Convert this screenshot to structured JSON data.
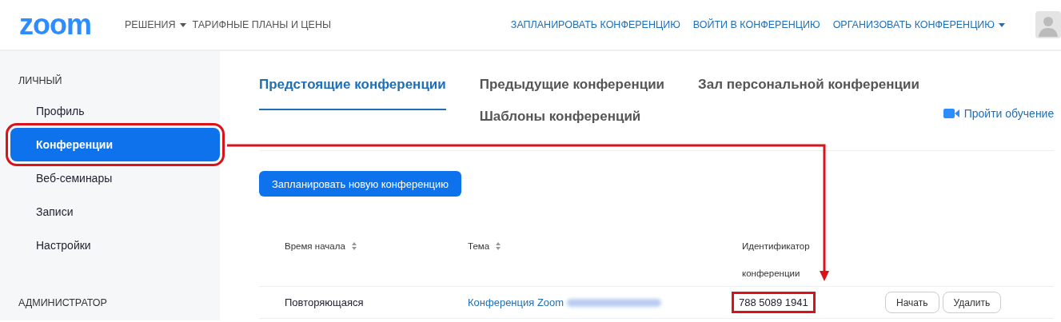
{
  "header": {
    "logo": "zoom",
    "nav_left": [
      {
        "label": "РЕШЕНИЯ",
        "dropdown": true
      },
      {
        "label": "ТАРИФНЫЕ ПЛАНЫ И ЦЕНЫ",
        "dropdown": false
      }
    ],
    "nav_right": [
      {
        "label": "ЗАПЛАНИРОВАТЬ КОНФЕРЕНЦИЮ",
        "dropdown": false
      },
      {
        "label": "ВОЙТИ В КОНФЕРЕНЦИЮ",
        "dropdown": false
      },
      {
        "label": "ОРГАНИЗОВАТЬ КОНФЕРЕНЦИЮ",
        "dropdown": true
      }
    ]
  },
  "sidebar": {
    "sections": [
      {
        "title": "ЛИЧНЫЙ",
        "items": [
          {
            "label": "Профиль",
            "selected": false,
            "highlighted": false
          },
          {
            "label": "Конференции",
            "selected": true,
            "highlighted": true
          },
          {
            "label": "Веб-семинары",
            "selected": false,
            "highlighted": false
          },
          {
            "label": "Записи",
            "selected": false,
            "highlighted": false
          },
          {
            "label": "Настройки",
            "selected": false,
            "highlighted": false
          }
        ]
      },
      {
        "title": "АДМИНИСТРАТОР"
      }
    ]
  },
  "tabs": [
    {
      "label": "Предстоящие конференции",
      "selected": true
    },
    {
      "label": "Предыдущие конференции",
      "selected": false
    },
    {
      "label": "Зал персональной конференции",
      "selected": false
    },
    {
      "label": "Шаблоны конференций",
      "selected": false
    }
  ],
  "training_link": "Пройти обучение",
  "schedule_button": "Запланировать новую конференцию",
  "table": {
    "columns": [
      {
        "label": "Время начала",
        "sortable": true
      },
      {
        "label": "Тема",
        "sortable": true
      },
      {
        "label": "Идентификатор конференции",
        "sortable": false
      }
    ],
    "rows": [
      {
        "start": "Повторяющаяся",
        "topic": "Конференция Zoom",
        "topic_blurred": true,
        "id": "788 5089 1941",
        "id_highlighted": true,
        "actions": [
          "Начать",
          "Удалить"
        ]
      }
    ]
  }
}
